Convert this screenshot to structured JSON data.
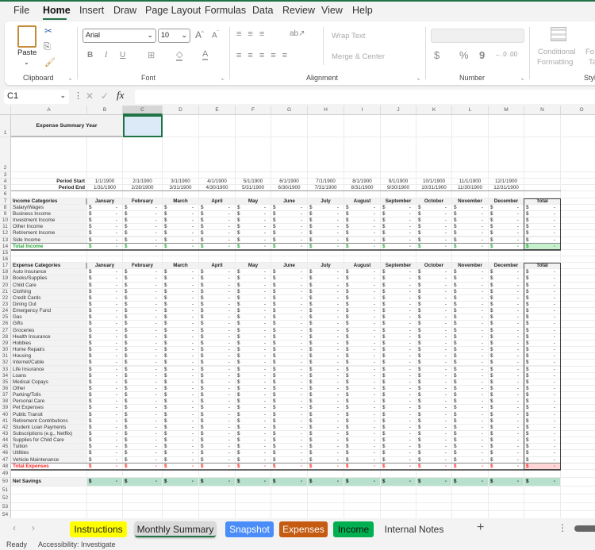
{
  "menu": [
    "File",
    "Home",
    "Insert",
    "Draw",
    "Page Layout",
    "Formulas",
    "Data",
    "Review",
    "View",
    "Help"
  ],
  "ribbon": {
    "clipboard": {
      "paste": "Paste",
      "label": "Clipboard"
    },
    "font": {
      "name": "Arial",
      "size": "10",
      "label": "Font",
      "bold": "B",
      "italic": "I",
      "underline": "U"
    },
    "alignment": {
      "wrap": "Wrap Text",
      "merge": "Merge & Center",
      "label": "Alignment"
    },
    "number": {
      "format": "",
      "currency": "$",
      "percent": "%",
      "comma": "9",
      "label": "Number"
    },
    "styles": {
      "conditional1": "Conditional",
      "conditional2": "Formatting",
      "label": "Styl",
      "format_as_table": "Fo",
      "table2": "Ta"
    }
  },
  "formula_bar": {
    "name_box": "C1",
    "cancel": "✕",
    "enter": "✓",
    "fx": "fx",
    "value": ""
  },
  "columns": [
    "A",
    "B",
    "C",
    "D",
    "E",
    "F",
    "G",
    "H",
    "I",
    "J",
    "K",
    "L",
    "M",
    "N",
    "O"
  ],
  "sheet": {
    "title": "Expense Summary Year",
    "period_start_label": "Period Start",
    "period_end_label": "Period End",
    "period_start": [
      "1/1/1900",
      "2/1/1900",
      "3/1/1900",
      "4/1/1900",
      "5/1/1900",
      "6/1/1900",
      "7/1/1900",
      "8/1/1900",
      "9/1/1900",
      "10/1/1900",
      "11/1/1900",
      "12/1/1900"
    ],
    "period_end": [
      "1/31/1900",
      "2/28/1900",
      "3/31/1900",
      "4/30/1900",
      "5/31/1900",
      "6/30/1900",
      "7/31/1900",
      "8/31/1900",
      "9/30/1900",
      "10/31/1900",
      "11/30/1900",
      "12/31/1900"
    ],
    "months": [
      "January",
      "February",
      "March",
      "April",
      "May",
      "June",
      "July",
      "August",
      "September",
      "October",
      "November",
      "December"
    ],
    "total_label": "Total",
    "currency_symbol": "$",
    "empty_value": "-",
    "income_header": "Income Categories",
    "income_items": [
      "Salary/Wages",
      "Business Income",
      "Investment Income",
      "Other Income",
      "Retirement Income",
      "Side Income"
    ],
    "total_income_label": "Total Income",
    "expense_header": "Expense Categories",
    "expense_items": [
      "Auto Insurance",
      "Books/Supplies",
      "Child Care",
      "Clothing",
      "Credit Cards",
      "Dining Out",
      "Emergency Fund",
      "Gas",
      "Gifts",
      "Groceries",
      "Health Insurance",
      "Hobbies",
      "Home Repairs",
      "Housing",
      "Internet/Cable",
      "Life Insurance",
      "Loans",
      "Medical Copays",
      "Other",
      "Parking/Tolls",
      "Personal Care",
      "Pet Expenses",
      "Public Transit",
      "Retirement Contributions",
      "Student Loan Payments",
      "Subscriptions (e.g., Netflix)",
      "Supplies for Child Care",
      "Tuition",
      "Utilities",
      "Vehicle Maintenance"
    ],
    "total_expenses_label": "Total Expenses",
    "net_savings_label": "Net Savings",
    "colors": {
      "income_total": "#22a83a",
      "expense_total": "#ff2020",
      "income_total_fill": "#c6efce",
      "expense_total_fill": "#ffd6d6",
      "net_savings_fill": "#b7e1cd",
      "selection": "#217346"
    }
  },
  "tabs": [
    {
      "label": "Instructions",
      "color": "#ffff00",
      "text": "#222"
    },
    {
      "label": "Monthly Summary",
      "color": "#d9d9d9",
      "text": "#222",
      "active": true
    },
    {
      "label": "Snapshot",
      "color": "#4a8df8",
      "text": "#fff"
    },
    {
      "label": "Expenses",
      "color": "#c55a11",
      "text": "#fff"
    },
    {
      "label": "Income",
      "color": "#00b050",
      "text": "#111"
    },
    {
      "label": "Internal Notes",
      "color": "",
      "text": "#333"
    }
  ],
  "add_sheet": "+",
  "status": {
    "ready": "Ready",
    "accessibility": "Accessibility: Investigate"
  }
}
